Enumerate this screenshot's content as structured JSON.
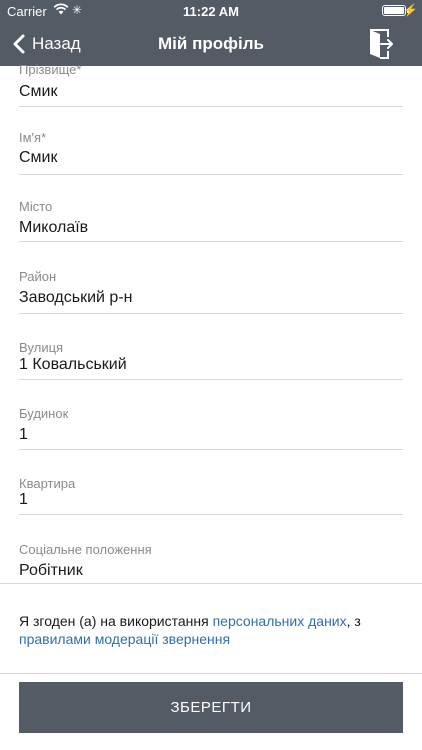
{
  "status": {
    "carrier": "Carrier",
    "time": "11:22 AM"
  },
  "nav": {
    "back_label": "Назад",
    "title": "Мій профіль"
  },
  "fields": [
    {
      "label": "Прізвище*",
      "value": "Смик"
    },
    {
      "label": "Ім'я*",
      "value": "Смик"
    },
    {
      "label": "Місто",
      "value": "Миколаїв"
    },
    {
      "label": "Район",
      "value": "Заводський р-н"
    },
    {
      "label": "Вулиця",
      "value": "1 Ковальський"
    },
    {
      "label": "Будинок",
      "value": "1"
    },
    {
      "label": "Квартира",
      "value": "1"
    },
    {
      "label": "Соціальне положення",
      "value": "Робітник"
    }
  ],
  "consent": {
    "text_1": "Я згоден (а) на використання ",
    "link_1": "персональних даних",
    "text_2": ", з ",
    "link_2": "правилами модерації звернення"
  },
  "save_label": "ЗБЕРЕГТИ",
  "colors": {
    "bar": "#535b64",
    "link": "#2f6fb0"
  }
}
